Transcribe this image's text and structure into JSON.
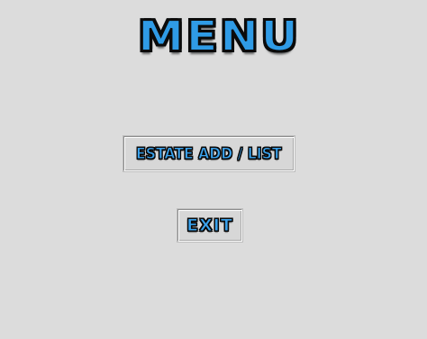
{
  "title": "MENU",
  "buttons": {
    "estate": "ESTATE ADD / LIST",
    "exit": "EXIT"
  },
  "colors": {
    "background": "#dcdcdc",
    "accent_blue": "#2f9be6",
    "outline": "#0b0b0b"
  }
}
